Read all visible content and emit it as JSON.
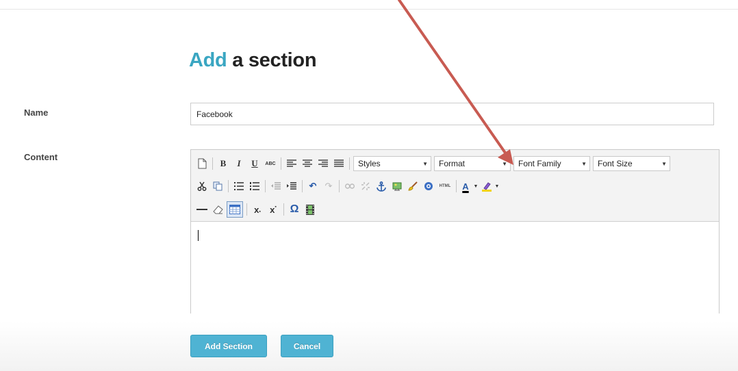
{
  "page": {
    "heading_accent": "Add",
    "heading_rest": "a section"
  },
  "form": {
    "name_label": "Name",
    "name_value": "Facebook",
    "content_label": "Content",
    "content_value": ""
  },
  "editor": {
    "dropdowns": {
      "styles": "Styles",
      "format": "Format",
      "font_family": "Font Family",
      "font_size": "Font Size"
    },
    "toolbar_glyphs": {
      "bold": "B",
      "italic": "I",
      "underline": "U",
      "strikethrough": "ABC",
      "undo": "↶",
      "redo": "↷",
      "html": "HTML",
      "charmap": "Ω",
      "text_color": "A",
      "subscript": "x",
      "superscript": "x"
    }
  },
  "buttons": {
    "add_section": "Add Section",
    "cancel": "Cancel"
  },
  "colors": {
    "accent": "#3aa6c2",
    "button": "#4fb3d3",
    "arrow": "#c85b52"
  }
}
